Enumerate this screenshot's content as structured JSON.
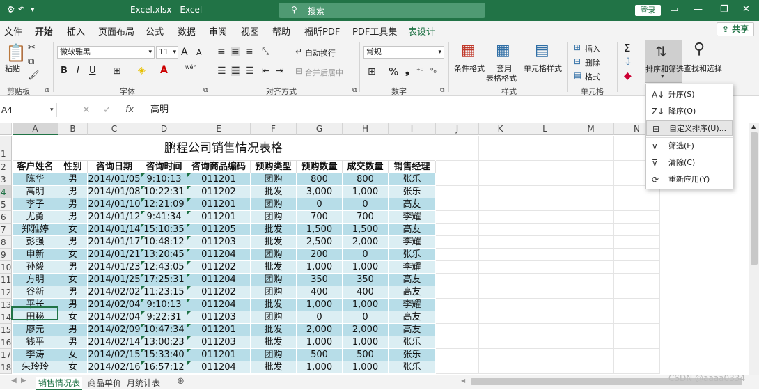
{
  "titlebar": {
    "autosave_icon": "autosave-icon",
    "undo_icon": "undo-icon",
    "filename": "Excel.xlsx",
    "sep": "-",
    "app": "Excel",
    "search_placeholder": "搜索",
    "login": "登录",
    "window_minimize": "—",
    "window_restore": "❐",
    "window_close": "✕"
  },
  "tabs": [
    "文件",
    "开始",
    "插入",
    "页面布局",
    "公式",
    "数据",
    "审阅",
    "视图",
    "帮助",
    "福昕PDF",
    "PDF工具集",
    "表设计"
  ],
  "share": "共享",
  "ribbon": {
    "clipboard": {
      "paste": "粘贴",
      "label": "剪贴板"
    },
    "font": {
      "name": "微软雅黑",
      "size": "11",
      "bold": "B",
      "italic": "I",
      "underline": "U",
      "grow": "A",
      "shrink": "A",
      "phonetic": "wén",
      "label": "字体"
    },
    "alignment": {
      "wrap": "自动换行",
      "merge": "合并后居中",
      "label": "对齐方式"
    },
    "number": {
      "format": "常规",
      "percent": "%",
      "comma": "❟",
      "label": "数字"
    },
    "styles": {
      "cond": "条件格式",
      "table": "套用",
      "table2": "表格格式",
      "cell": "单元格样式",
      "label": "样式"
    },
    "cells": {
      "insert": "插入",
      "delete": "删除",
      "format": "格式",
      "label": "单元格"
    },
    "editing": {
      "sort": "排序和筛选",
      "find": "查找和选择",
      "sum": "Σ"
    }
  },
  "formula": {
    "namebox": "A4",
    "fx": "fx",
    "value": "高明"
  },
  "columns": [
    "A",
    "B",
    "C",
    "D",
    "E",
    "F",
    "G",
    "H",
    "I",
    "J",
    "K",
    "L",
    "M",
    "N"
  ],
  "title": "鹏程公司销售情况表格",
  "headers": [
    "客户姓名",
    "性别",
    "咨询日期",
    "咨询时间",
    "咨询商品编码",
    "预购类型",
    "预购数量",
    "成交数量",
    "销售经理"
  ],
  "rows": [
    [
      "陈华",
      "男",
      "2014/01/05",
      "9:10:13",
      "011201",
      "团购",
      "800",
      "800",
      "张乐"
    ],
    [
      "高明",
      "男",
      "2014/01/08",
      "10:22:31",
      "011202",
      "批发",
      "3,000",
      "1,000",
      "张乐"
    ],
    [
      "李子",
      "男",
      "2014/01/10",
      "12:21:09",
      "011201",
      "团购",
      "0",
      "0",
      "高友"
    ],
    [
      "尤勇",
      "男",
      "2014/01/12",
      "9:41:34",
      "011201",
      "团购",
      "700",
      "700",
      "李耀"
    ],
    [
      "郑雅婷",
      "女",
      "2014/01/14",
      "15:10:35",
      "011205",
      "批发",
      "1,500",
      "1,500",
      "高友"
    ],
    [
      "彭强",
      "男",
      "2014/01/17",
      "10:48:12",
      "011203",
      "批发",
      "2,500",
      "2,000",
      "李耀"
    ],
    [
      "申新",
      "女",
      "2014/01/21",
      "13:20:45",
      "011204",
      "团购",
      "200",
      "0",
      "张乐"
    ],
    [
      "孙毅",
      "男",
      "2014/01/23",
      "12:43:05",
      "011202",
      "批发",
      "1,000",
      "1,000",
      "李耀"
    ],
    [
      "方明",
      "女",
      "2014/01/25",
      "17:25:31",
      "011204",
      "团购",
      "350",
      "350",
      "高友"
    ],
    [
      "谷新",
      "男",
      "2014/02/02",
      "11:23:15",
      "011202",
      "团购",
      "400",
      "400",
      "高友"
    ],
    [
      "平长",
      "男",
      "2014/02/04",
      "9:10:13",
      "011204",
      "批发",
      "1,000",
      "1,000",
      "李耀"
    ],
    [
      "田秘",
      "女",
      "2014/02/04",
      "9:22:31",
      "011203",
      "团购",
      "0",
      "0",
      "高友"
    ],
    [
      "廖元",
      "男",
      "2014/02/09",
      "10:47:34",
      "011201",
      "批发",
      "2,000",
      "2,000",
      "高友"
    ],
    [
      "钱平",
      "男",
      "2014/02/14",
      "13:00:23",
      "011203",
      "批发",
      "1,000",
      "1,000",
      "张乐"
    ],
    [
      "李涛",
      "女",
      "2014/02/15",
      "15:33:40",
      "011201",
      "团购",
      "500",
      "500",
      "张乐"
    ],
    [
      "朱玲玲",
      "女",
      "2014/02/16",
      "16:57:12",
      "011204",
      "批发",
      "1,000",
      "1,000",
      "张乐"
    ]
  ],
  "row_numbers": [
    "1",
    "2",
    "3",
    "4",
    "5",
    "6",
    "7",
    "8",
    "9",
    "10",
    "11",
    "12",
    "13",
    "14",
    "15",
    "16",
    "17",
    "18"
  ],
  "sort_menu": [
    {
      "icon": "sort-ascending-icon",
      "label": "升序(S)"
    },
    {
      "icon": "sort-descending-icon",
      "label": "降序(O)"
    },
    {
      "icon": "custom-sort-icon",
      "label": "自定义排序(U)..."
    },
    {
      "icon": "filter-icon",
      "label": "筛选(F)"
    },
    {
      "icon": "clear-filter-icon",
      "label": "清除(C)"
    },
    {
      "icon": "reapply-icon",
      "label": "重新应用(Y)"
    }
  ],
  "sheet_tabs": [
    "销售情况表",
    "商品单价",
    "月统计表"
  ],
  "watermark": "CSDN @aaaa0334",
  "colors": {
    "excel_green": "#217346",
    "band_dark": "#b7dde8",
    "band_light": "#dbeef3"
  }
}
